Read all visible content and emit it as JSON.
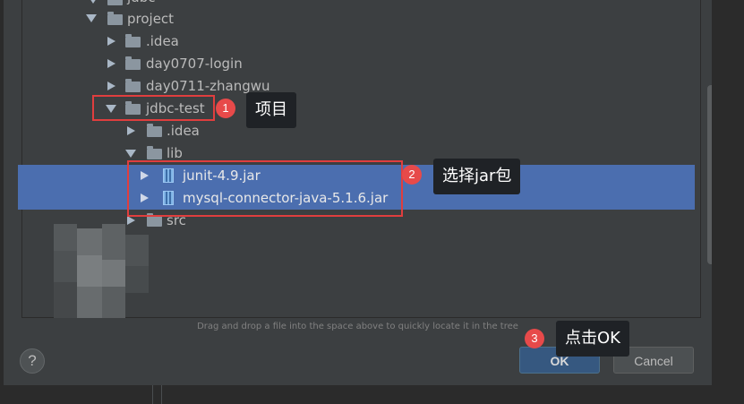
{
  "tree": {
    "rows": [
      {
        "label": "jdbc",
        "expanded": true
      },
      {
        "label": "project",
        "expanded": true
      },
      {
        "label": ".idea",
        "expanded": false
      },
      {
        "label": "day0707-login",
        "expanded": false
      },
      {
        "label": "day0711-zhangwu",
        "expanded": false
      },
      {
        "label": "jdbc-test",
        "expanded": true
      },
      {
        "label": ".idea",
        "expanded": false
      },
      {
        "label": "lib",
        "expanded": true
      },
      {
        "label": "junit-4.9.jar",
        "type": "jar"
      },
      {
        "label": "mysql-connector-java-5.1.6.jar",
        "type": "jar"
      },
      {
        "label": "src",
        "expanded": false
      }
    ]
  },
  "annotations": {
    "step1": {
      "num": "1",
      "text": "项目"
    },
    "step2": {
      "num": "2",
      "text": "选择jar包"
    },
    "step3": {
      "num": "3",
      "text": "点击OK"
    }
  },
  "hint": "Drag and drop a file into the space above to quickly locate it in the tree",
  "buttons": {
    "help": "?",
    "ok": "OK",
    "cancel": "Cancel"
  },
  "colors": {
    "selection": "#4b6eaf",
    "annotation_red": "#e03e3e",
    "dialog_bg": "#3c3f41"
  },
  "icons": {
    "folder": "folder-icon",
    "jar": "jar-file-icon",
    "expand": "chevron-right-icon",
    "collapse": "chevron-down-icon"
  }
}
